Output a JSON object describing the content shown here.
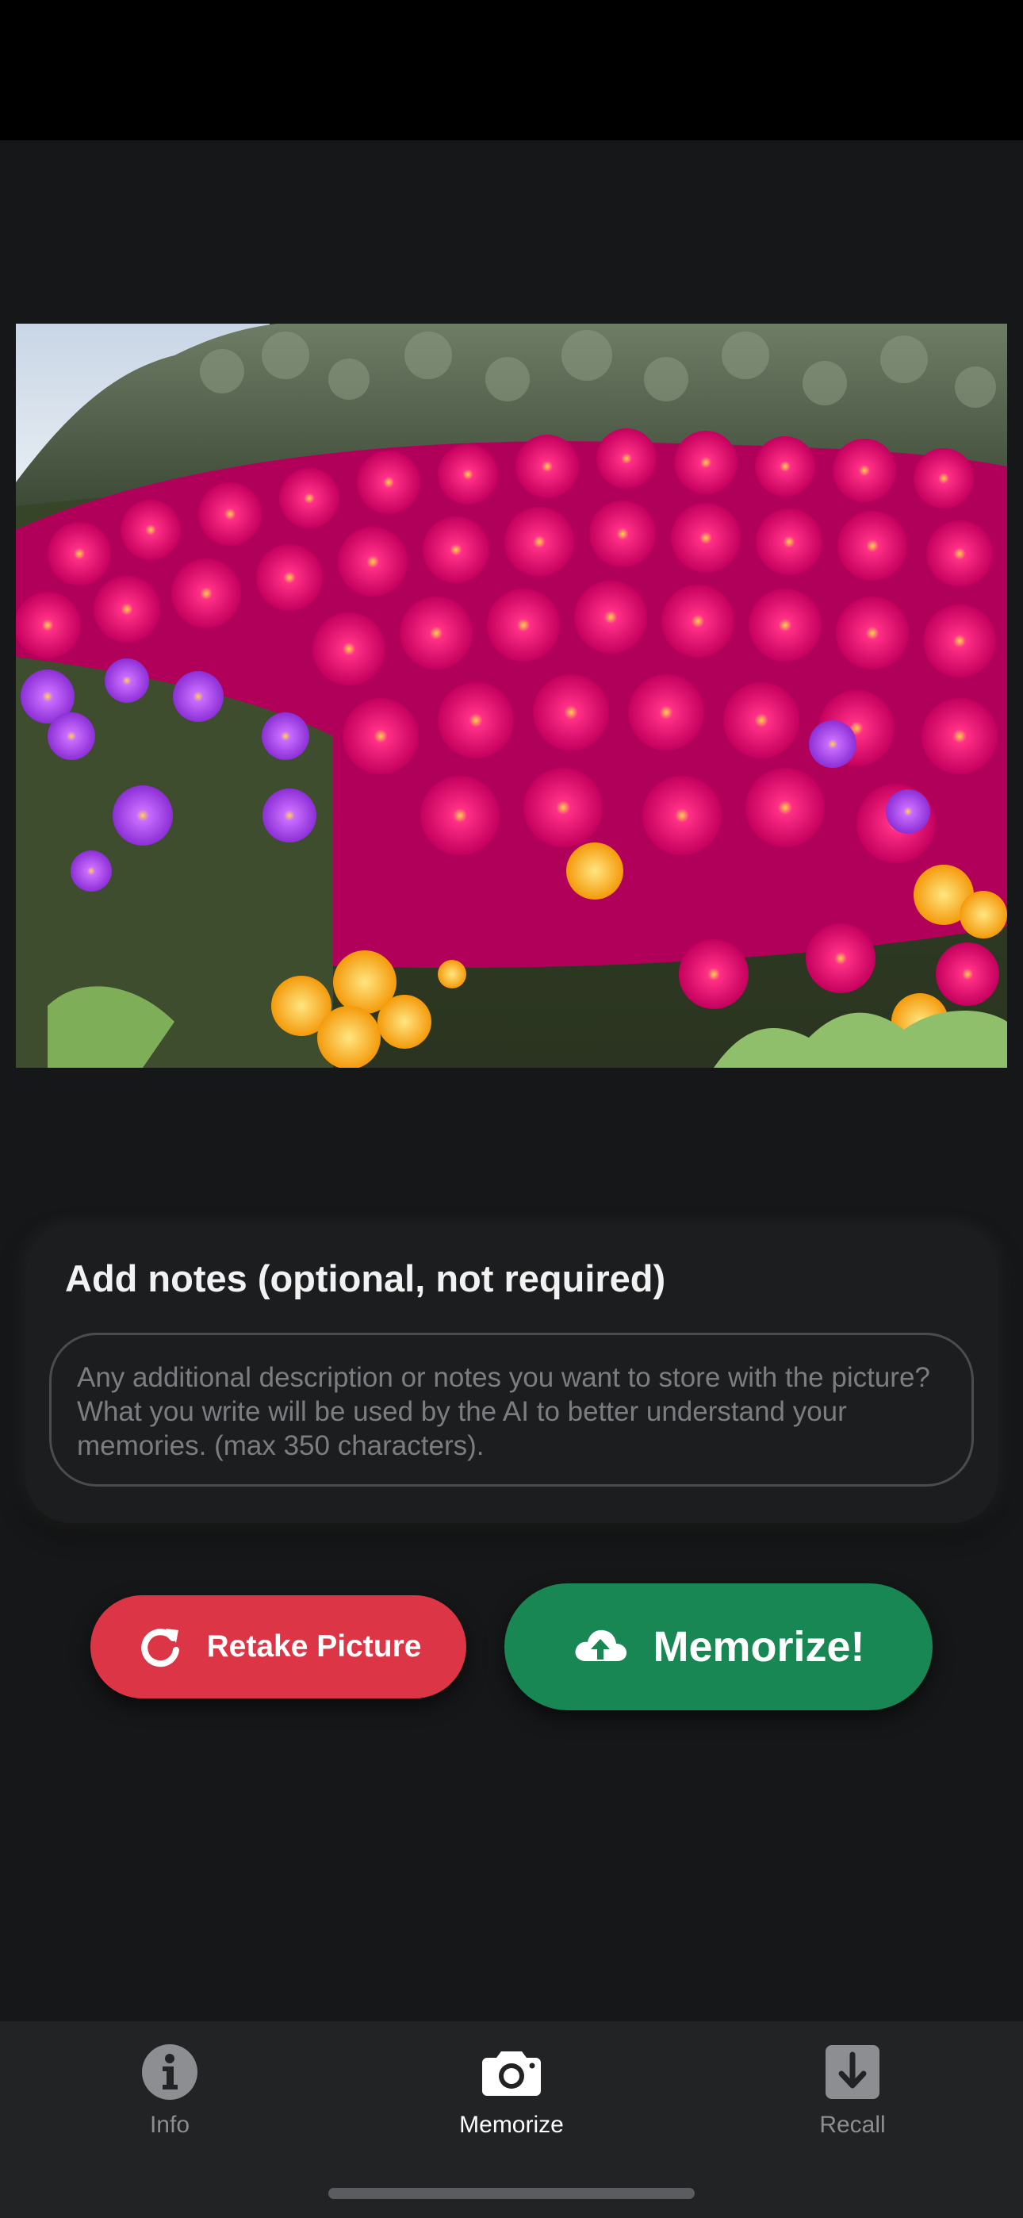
{
  "notes": {
    "title": "Add notes (optional, not required)",
    "placeholder": "Any additional description or notes you want to store with the picture? What you write will be used by the AI to better understand your memories. (max 350 characters).",
    "value": ""
  },
  "actions": {
    "retake_label": "Retake Picture",
    "retake_icon": "rotate-right-icon",
    "memorize_label": "Memorize!",
    "memorize_icon": "cloud-upload-icon"
  },
  "tabs": [
    {
      "label": "Info",
      "icon": "info-circle-icon",
      "active": false
    },
    {
      "label": "Memorize",
      "icon": "camera-icon",
      "active": true
    },
    {
      "label": "Recall",
      "icon": "download-box-icon",
      "active": false
    }
  ],
  "colors": {
    "background": "#161718",
    "card": "#1c1d1f",
    "retake": "#dc3545",
    "memorize": "#198754",
    "tab_bar": "#222325",
    "tab_inactive": "#8d8e91"
  }
}
